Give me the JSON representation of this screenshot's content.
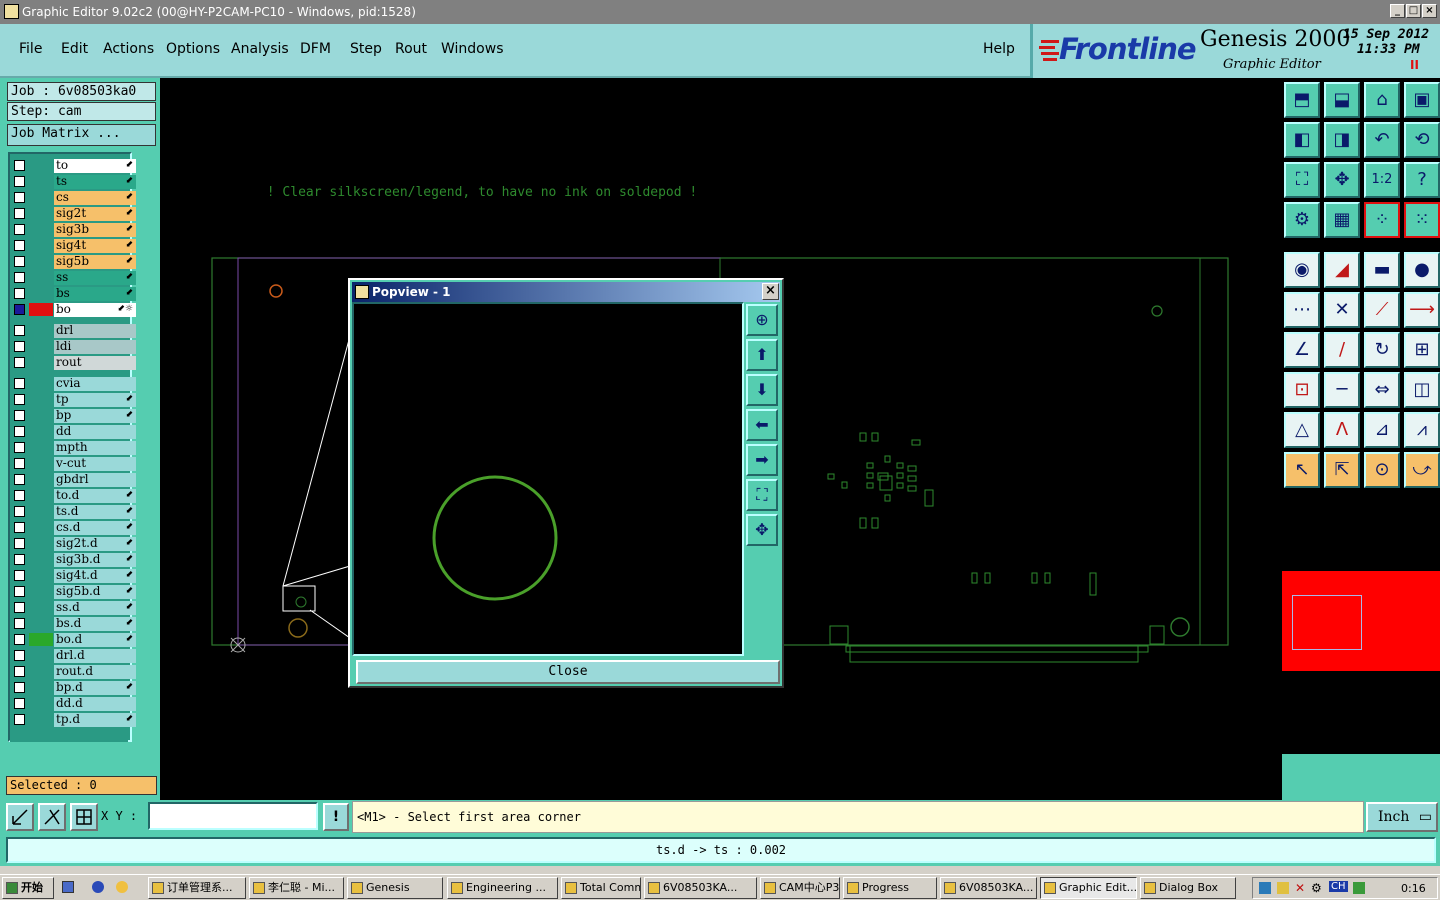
{
  "window": {
    "title": "Graphic Editor 9.02c2 (00@HY-P2CAM-PC10 - Windows, pid:1528)",
    "minimize": "_",
    "maximize": "□",
    "close": "×"
  },
  "menu": {
    "items": [
      "File",
      "Edit",
      "Actions",
      "Options",
      "Analysis",
      "DFM",
      "Step",
      "Rout",
      "Windows"
    ],
    "help": "Help"
  },
  "brand": {
    "logo": "Frontline",
    "product": "Genesis 2000",
    "subtitle": "Graphic Editor",
    "date": "15 Sep 2012",
    "time": "11:33 PM",
    "pause": "II"
  },
  "job": {
    "job_label": "Job  :  6v08503ka0",
    "step_label": "Step:  cam",
    "matrix_button": "Job Matrix ..."
  },
  "layers_group1": [
    {
      "name": "to",
      "color": "#ffffff",
      "arrow": "⬋"
    },
    {
      "name": "ts",
      "color": "#2aa88a",
      "arrow": "⬋"
    },
    {
      "name": "cs",
      "color": "#f6c06a",
      "arrow": "⬋"
    },
    {
      "name": "sig2t",
      "color": "#f6c06a",
      "arrow": "⬋"
    },
    {
      "name": "sig3b",
      "color": "#f6c06a",
      "arrow": "⬋"
    },
    {
      "name": "sig4t",
      "color": "#f6c06a",
      "arrow": "⬋"
    },
    {
      "name": "sig5b",
      "color": "#f6c06a",
      "arrow": "⬋"
    },
    {
      "name": "ss",
      "color": "#2aa88a",
      "arrow": "⬋"
    },
    {
      "name": "bs",
      "color": "#2aa88a",
      "arrow": "⬋"
    },
    {
      "name": "bo",
      "color": "#ffffff",
      "arrow": "⬋☼"
    }
  ],
  "layers_group2": [
    {
      "name": "drl",
      "color": "#a8c8c8",
      "arrow": ""
    },
    {
      "name": "ldi",
      "color": "#a8c8c8",
      "arrow": ""
    },
    {
      "name": "rout",
      "color": "#d0d8d8",
      "arrow": ""
    }
  ],
  "layers_group3": [
    {
      "name": "cvia",
      "arrow": ""
    },
    {
      "name": "tp",
      "arrow": "⬋"
    },
    {
      "name": "bp",
      "arrow": "⬋"
    },
    {
      "name": "dd",
      "arrow": ""
    },
    {
      "name": "mpth",
      "arrow": ""
    },
    {
      "name": "v-cut",
      "arrow": ""
    },
    {
      "name": "gbdrl",
      "arrow": ""
    },
    {
      "name": "to.d",
      "arrow": "⬋"
    },
    {
      "name": "ts.d",
      "arrow": "⬋"
    },
    {
      "name": "cs.d",
      "arrow": "⬋"
    },
    {
      "name": "sig2t.d",
      "arrow": "⬋"
    },
    {
      "name": "sig3b.d",
      "arrow": "⬋"
    },
    {
      "name": "sig4t.d",
      "arrow": "⬋"
    },
    {
      "name": "sig5b.d",
      "arrow": "⬋"
    },
    {
      "name": "ss.d",
      "arrow": "⬋"
    },
    {
      "name": "bs.d",
      "arrow": "⬋"
    },
    {
      "name": "bo.d",
      "arrow": "⬋"
    },
    {
      "name": "drl.d",
      "arrow": ""
    },
    {
      "name": "rout.d",
      "arrow": ""
    },
    {
      "name": "bp.d",
      "arrow": "⬋"
    },
    {
      "name": "dd.d",
      "arrow": ""
    },
    {
      "name": "tp.d",
      "arrow": "⬋"
    }
  ],
  "selected": "Selected : 0",
  "canvas": {
    "message": "! Clear silkscreen/legend, to have no ink on soldepod !"
  },
  "popview": {
    "title": "Popview - 1",
    "close_button": "Close"
  },
  "command": {
    "xy_label": "X Y :",
    "xy_value": "",
    "excl": "!",
    "prompt": "<M1> - Select first area corner",
    "units": "Inch"
  },
  "status": {
    "text": "ts.d -> ts : 0.002"
  },
  "taskbar": {
    "start": "开始",
    "tasks": [
      "订单管理系...",
      "李仁聪 - Mi...",
      "Genesis",
      "Engineering ...",
      "Total Comm...",
      "6V08503KA...",
      "CAM中心P3...",
      "Progress",
      "6V08503KA...",
      "Graphic Edit...",
      "Dialog Box"
    ],
    "clock": "0:16",
    "ime": "CH"
  }
}
